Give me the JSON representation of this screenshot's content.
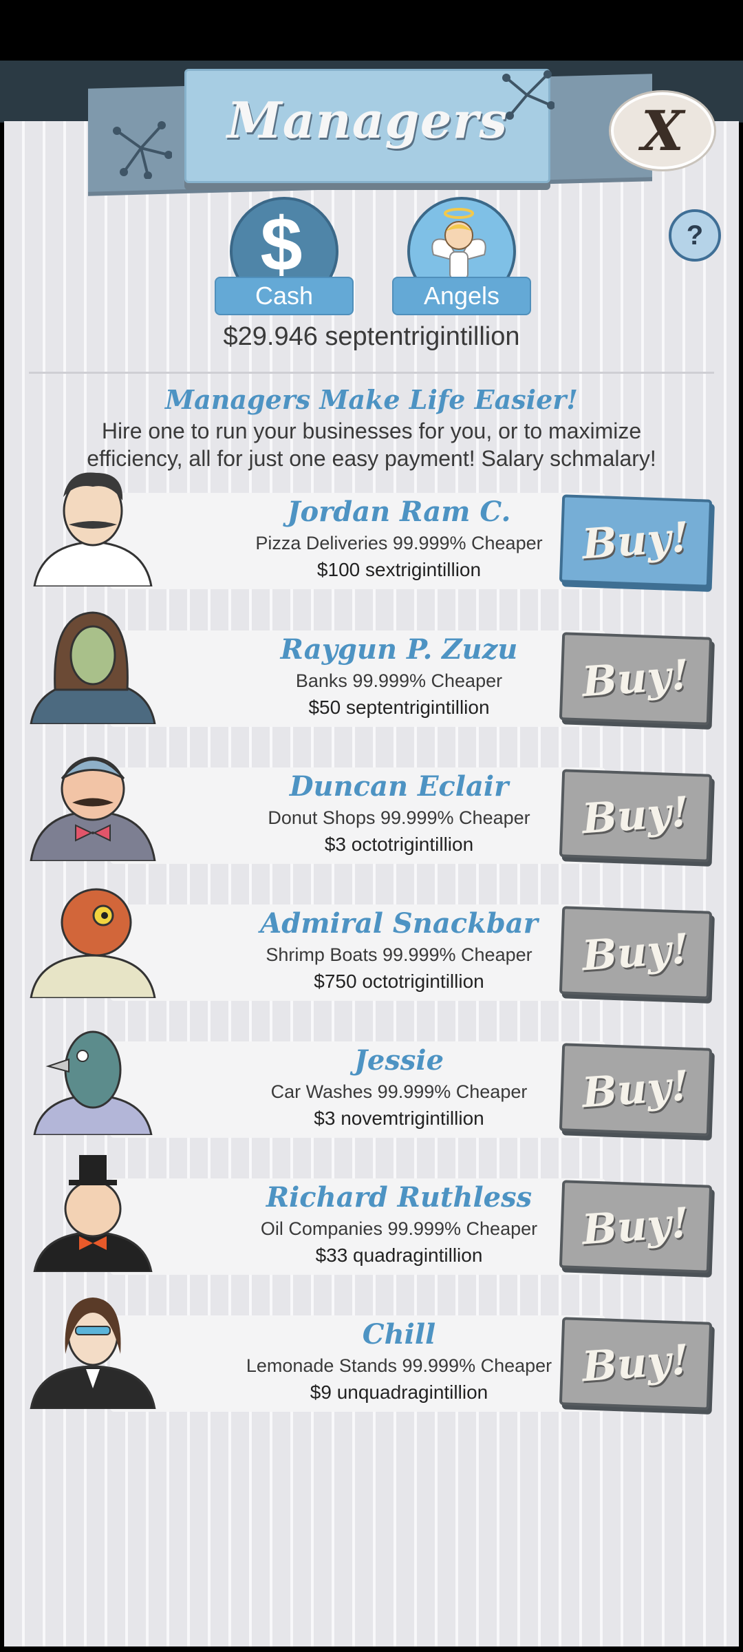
{
  "header": {
    "title": "Managers",
    "close_label": "X",
    "help_label": "?"
  },
  "currency": {
    "cash_label": "Cash",
    "cash_symbol": "$",
    "angels_label": "Angels",
    "amount": "$29.946 septentrigintillion"
  },
  "intro": {
    "title": "Managers Make Life Easier!",
    "description": "Hire one to run your businesses for you, or to maximize efficiency, all for just one easy payment! Salary schmalary!"
  },
  "buy_label": "Buy!",
  "managers": [
    {
      "name": "Jordan Ram C.",
      "desc": "Pizza Deliveries 99.999% Cheaper",
      "price": "$100 sextrigintillion",
      "affordable": true
    },
    {
      "name": "Raygun P. Zuzu",
      "desc": "Banks 99.999% Cheaper",
      "price": "$50 septentrigintillion",
      "affordable": false
    },
    {
      "name": "Duncan Eclair",
      "desc": "Donut Shops 99.999% Cheaper",
      "price": "$3 octotrigintillion",
      "affordable": false
    },
    {
      "name": "Admiral Snackbar",
      "desc": "Shrimp Boats 99.999% Cheaper",
      "price": "$750 octotrigintillion",
      "affordable": false
    },
    {
      "name": "Jessie",
      "desc": "Car Washes 99.999% Cheaper",
      "price": "$3 novemtrigintillion",
      "affordable": false
    },
    {
      "name": "Richard Ruthless",
      "desc": "Oil Companies 99.999% Cheaper",
      "price": "$33 quadragintillion",
      "affordable": false
    },
    {
      "name": "Chill",
      "desc": "Lemonade Stands 99.999% Cheaper",
      "price": "$9 unquadragintillion",
      "affordable": false
    }
  ]
}
